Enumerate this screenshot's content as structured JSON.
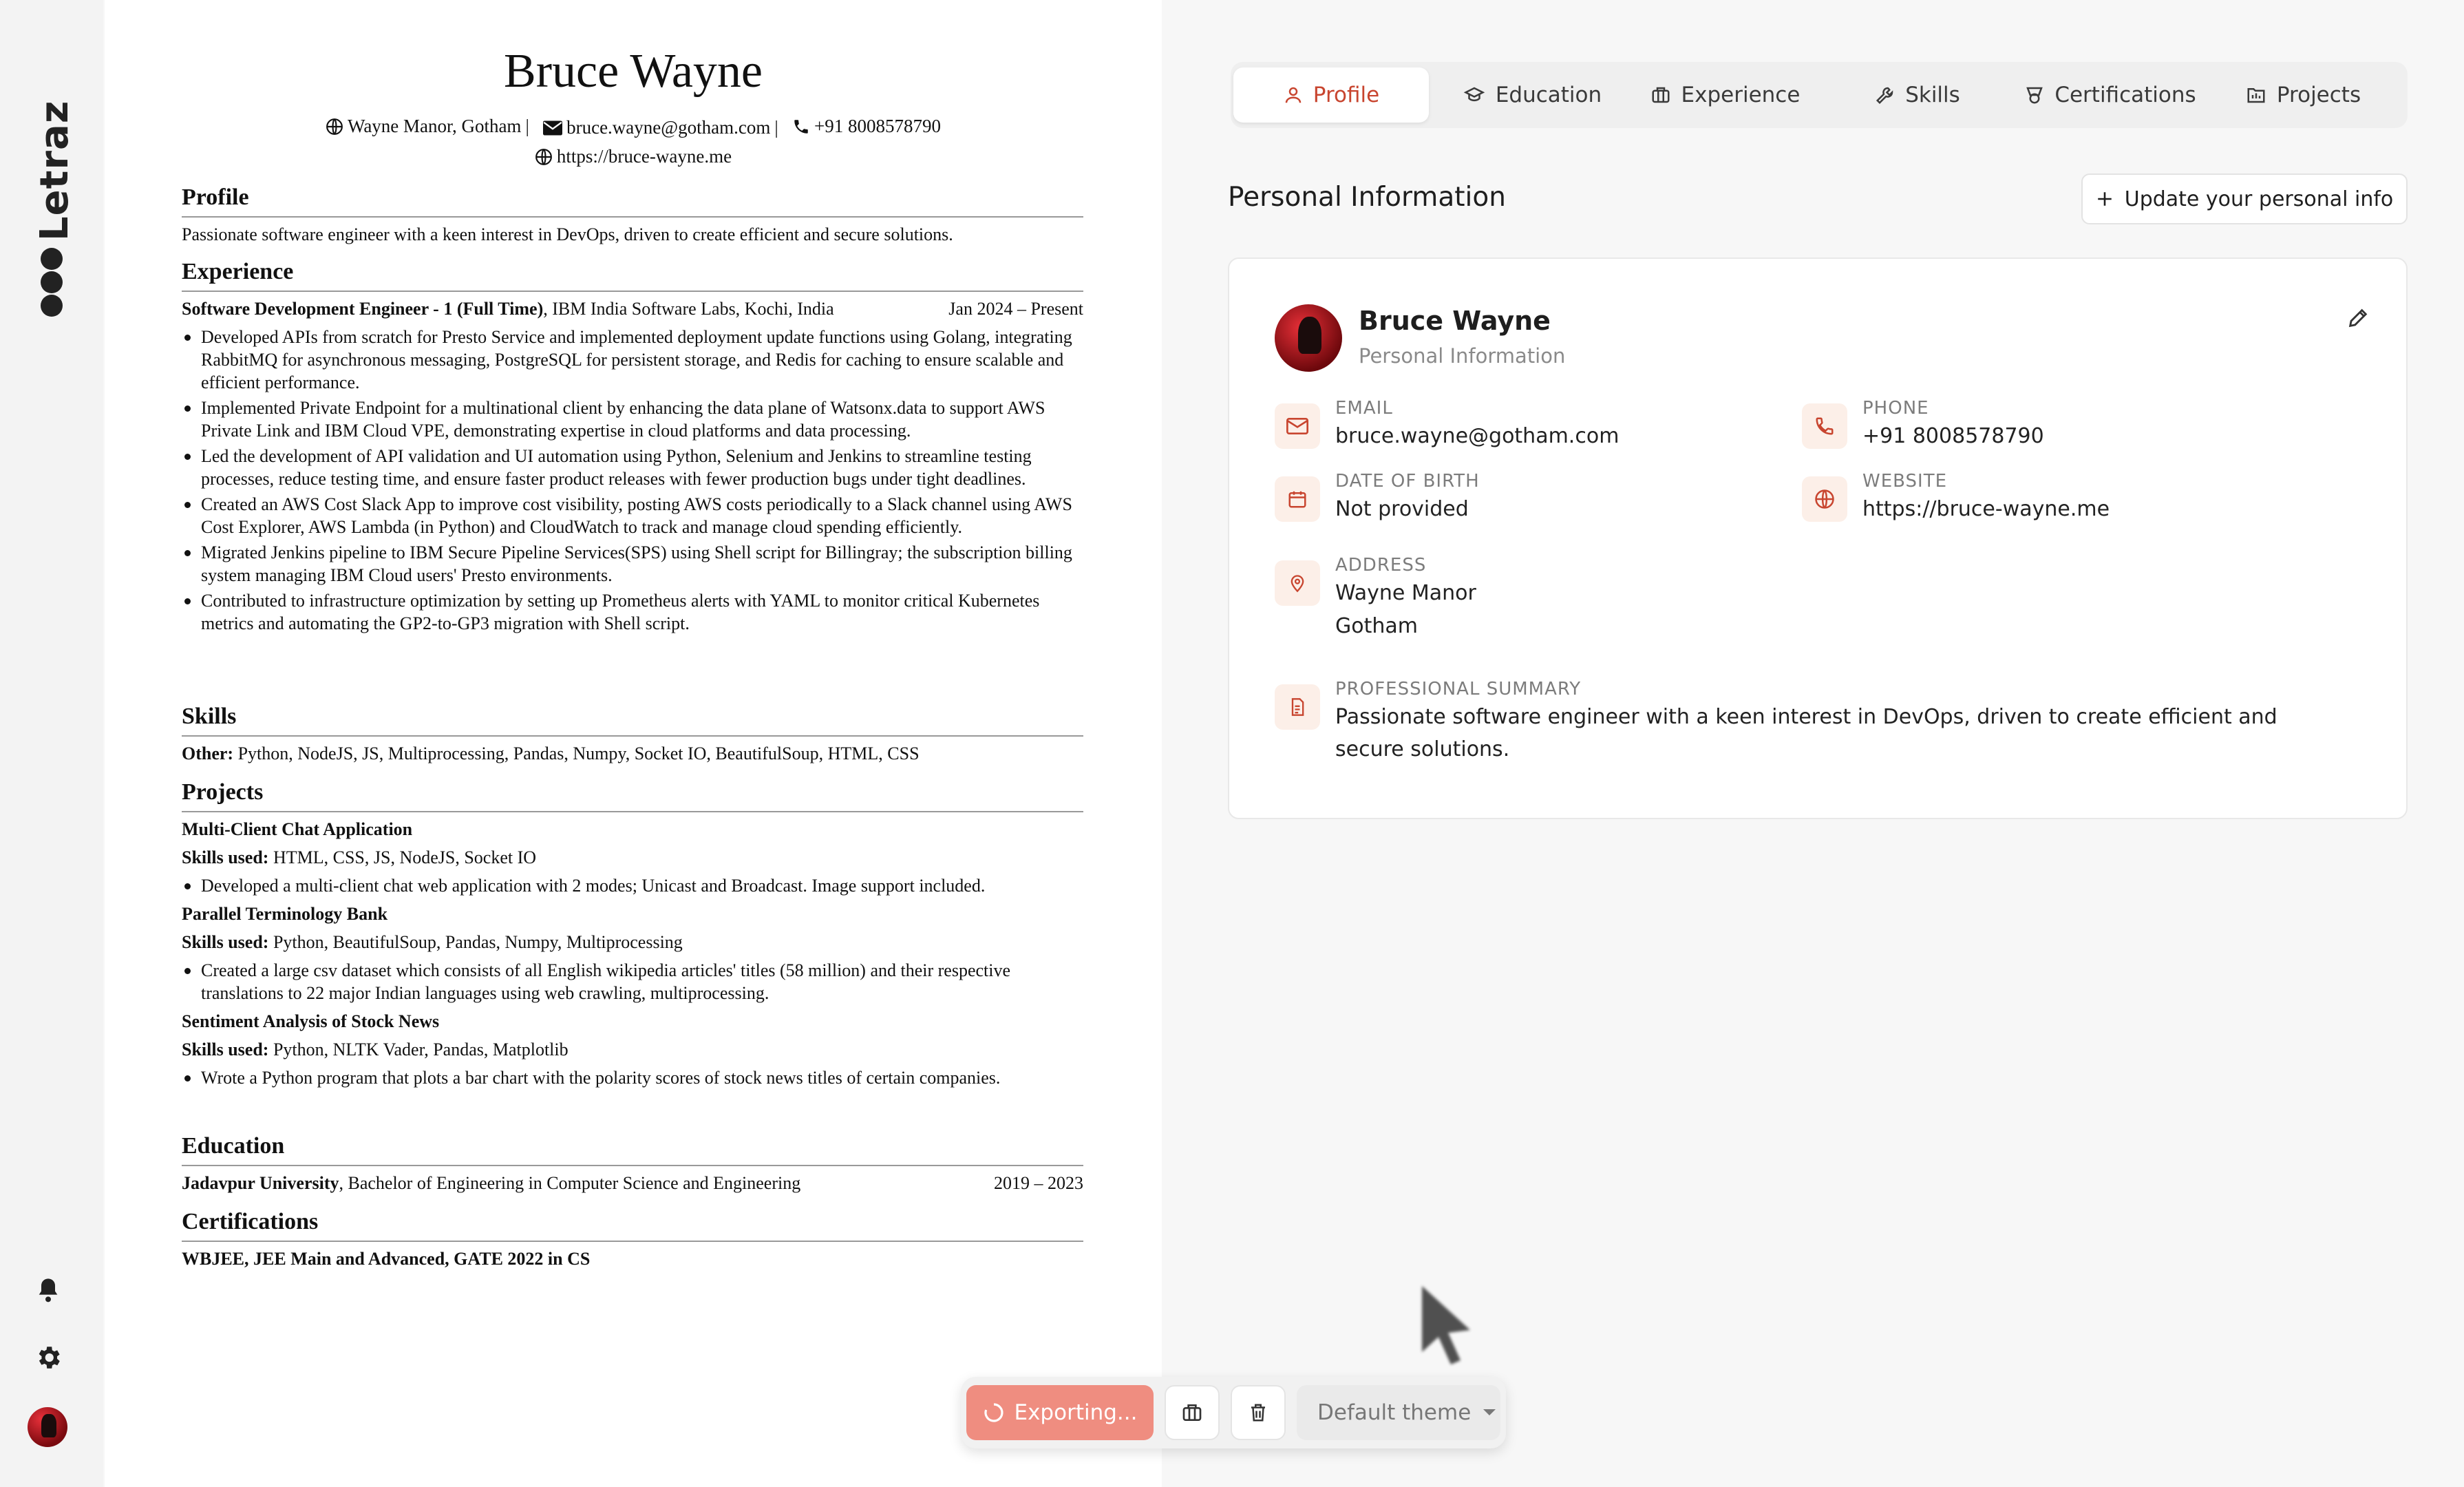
{
  "app": {
    "brand": "Letraz",
    "accent_color": "#c8452f"
  },
  "rail": {
    "icons": [
      "bell-icon",
      "gear-icon",
      "avatar"
    ]
  },
  "resume": {
    "name": "Bruce Wayne",
    "contact": {
      "location": "Wayne Manor, Gotham",
      "sep1": "|",
      "email": "bruce.wayne@gotham.com",
      "sep2": "|",
      "phone": "+91 8008578790",
      "website": "https://bruce-wayne.me"
    },
    "profile": {
      "heading": "Profile",
      "text": "Passionate software engineer with a keen interest in DevOps, driven to create efficient and secure solutions."
    },
    "experience": {
      "heading": "Experience",
      "role": "Software Development Engineer - 1 (Full Time)",
      "company": ", IBM India Software Labs, Kochi, India",
      "dates": "Jan 2024 – Present",
      "bullets": [
        "Developed APIs from scratch for Presto Service and implemented deployment update functions using Golang, integrating RabbitMQ for asynchronous messaging, PostgreSQL for persistent storage, and Redis for caching to ensure scalable and efficient performance.",
        "Implemented Private Endpoint for a multinational client by enhancing the data plane of Watsonx.data to support AWS Private Link and IBM Cloud VPE, demonstrating expertise in cloud platforms and data processing.",
        "Led the development of API validation and UI automation using Python, Selenium and Jenkins to streamline testing processes, reduce testing time, and ensure faster product releases with fewer production bugs under tight deadlines.",
        "Created an AWS Cost Slack App to improve cost visibility, posting AWS costs periodically to a Slack channel using AWS Cost Explorer, AWS Lambda (in Python) and CloudWatch to track and manage cloud spending efficiently.",
        "Migrated Jenkins pipeline to IBM Secure Pipeline Services(SPS) using Shell script for Billingray; the subscription billing system managing IBM Cloud users' Presto environments.",
        "Contributed to infrastructure optimization by setting up Prometheus alerts with YAML to monitor critical Kubernetes metrics and automating the GP2-to-GP3 migration with Shell script."
      ]
    },
    "skills": {
      "heading": "Skills",
      "label": "Other:",
      "text": " Python, NodeJS, JS, Multiprocessing, Pandas, Numpy, Socket IO, BeautifulSoup, HTML, CSS"
    },
    "projects": {
      "heading": "Projects",
      "skills_label": "Skills used:",
      "items": [
        {
          "title": "Multi-Client Chat Application",
          "skills": " HTML, CSS, JS, NodeJS, Socket IO",
          "bullet": "Developed a multi-client chat web application with 2 modes; Unicast and Broadcast. Image support included."
        },
        {
          "title": "Parallel Terminology Bank",
          "skills": " Python, BeautifulSoup, Pandas, Numpy, Multiprocessing",
          "bullet": "Created a large csv dataset which consists of all English wikipedia articles' titles (58 million) and their respective translations to 22 major Indian languages using web crawling, multiprocessing."
        },
        {
          "title": "Sentiment Analysis of Stock News",
          "skills": " Python, NLTK Vader, Pandas, Matplotlib",
          "bullet": "Wrote a Python program that plots a bar chart with the polarity scores of stock news titles of certain companies."
        }
      ]
    },
    "education": {
      "heading": "Education",
      "school": "Jadavpur University",
      "degree": ", Bachelor of Engineering in Computer Science and Engineering",
      "dates": "2019 – 2023"
    },
    "certifications": {
      "heading": "Certifications",
      "text": "WBJEE, JEE Main and Advanced, GATE 2022 in CS"
    }
  },
  "tabs": [
    {
      "label": "Profile",
      "icon": "user-icon",
      "active": true
    },
    {
      "label": "Education",
      "icon": "graduation-cap-icon",
      "active": false
    },
    {
      "label": "Experience",
      "icon": "briefcase-icon",
      "active": false
    },
    {
      "label": "Skills",
      "icon": "wrench-icon",
      "active": false
    },
    {
      "label": "Certifications",
      "icon": "award-icon",
      "active": false
    },
    {
      "label": "Projects",
      "icon": "folder-icon",
      "active": false
    }
  ],
  "panel": {
    "title": "Personal Information",
    "update_button": "Update your personal info",
    "card": {
      "name": "Bruce Wayne",
      "subtitle": "Personal Information",
      "fields": {
        "email": {
          "label": "EMAIL",
          "value": "bruce.wayne@gotham.com"
        },
        "phone": {
          "label": "PHONE",
          "value": "+91 8008578790"
        },
        "dob": {
          "label": "DATE OF BIRTH",
          "value": "Not provided"
        },
        "website": {
          "label": "WEBSITE",
          "value": "https://bruce-wayne.me"
        },
        "address": {
          "label": "ADDRESS",
          "line1": "Wayne Manor",
          "line2": "Gotham"
        },
        "summary": {
          "label": "PROFESSIONAL SUMMARY",
          "value": "Passionate software engineer with a keen interest in DevOps, driven to create efficient and secure solutions."
        }
      }
    }
  },
  "toolbar": {
    "export_label": "Exporting...",
    "theme_label": "Default theme"
  }
}
